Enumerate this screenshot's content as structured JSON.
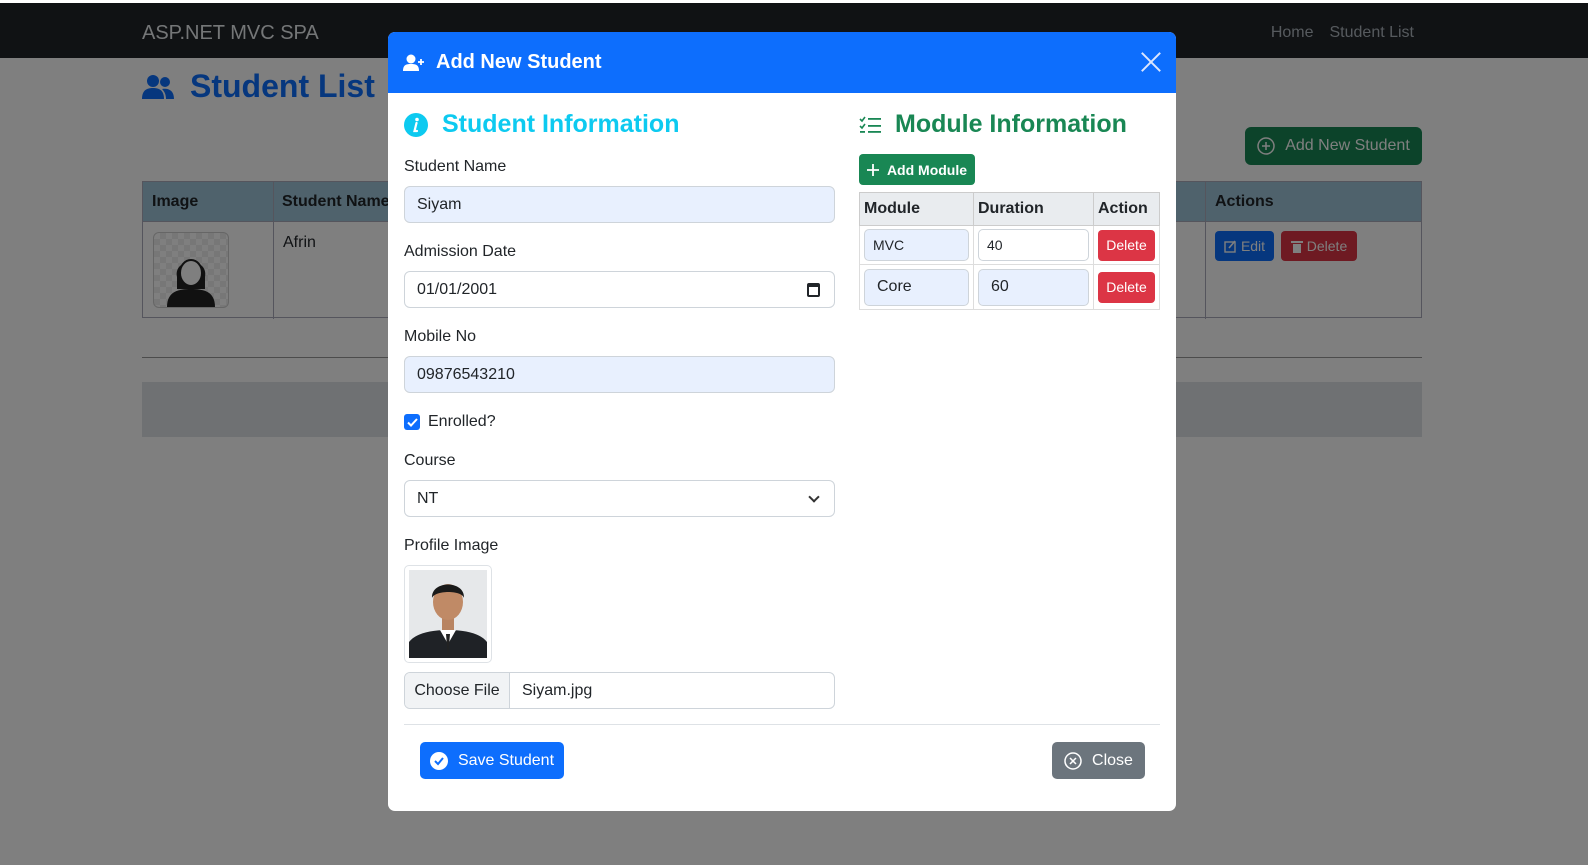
{
  "navbar": {
    "brand": "ASP.NET MVC SPA",
    "links": [
      "Home",
      "Student List"
    ]
  },
  "page": {
    "title": "Student List",
    "add_button": "Add New Student"
  },
  "student_table": {
    "headers": [
      "Image",
      "Student Name",
      "Actions"
    ],
    "rows": [
      {
        "name": "Afrin",
        "edit": "Edit",
        "delete": "Delete"
      }
    ]
  },
  "modal": {
    "title": "Add New Student",
    "student_section": {
      "title": "Student Information",
      "name_label": "Student Name",
      "name_value": "Siyam",
      "date_label": "Admission Date",
      "date_value": "01/01/2001",
      "mobile_label": "Mobile No",
      "mobile_value": "09876543210",
      "enrolled_label": "Enrolled?",
      "enrolled_checked": true,
      "course_label": "Course",
      "course_value": "NT",
      "image_label": "Profile Image",
      "file_button": "Choose File",
      "file_name": "Siyam.jpg"
    },
    "module_section": {
      "title": "Module Information",
      "add_button": "Add Module",
      "headers": [
        "Module",
        "Duration",
        "Action"
      ],
      "rows": [
        {
          "module": "MVC",
          "duration": "40",
          "action": "Delete"
        },
        {
          "module": "Core",
          "duration": "60",
          "action": "Delete"
        }
      ]
    },
    "save_button": "Save Student",
    "close_button": "Close"
  },
  "colors": {
    "primary": "#0d6efd",
    "success": "#198754",
    "info": "#0dcaf0",
    "danger": "#dc3545",
    "secondary": "#6c757d",
    "dark": "#212529"
  }
}
